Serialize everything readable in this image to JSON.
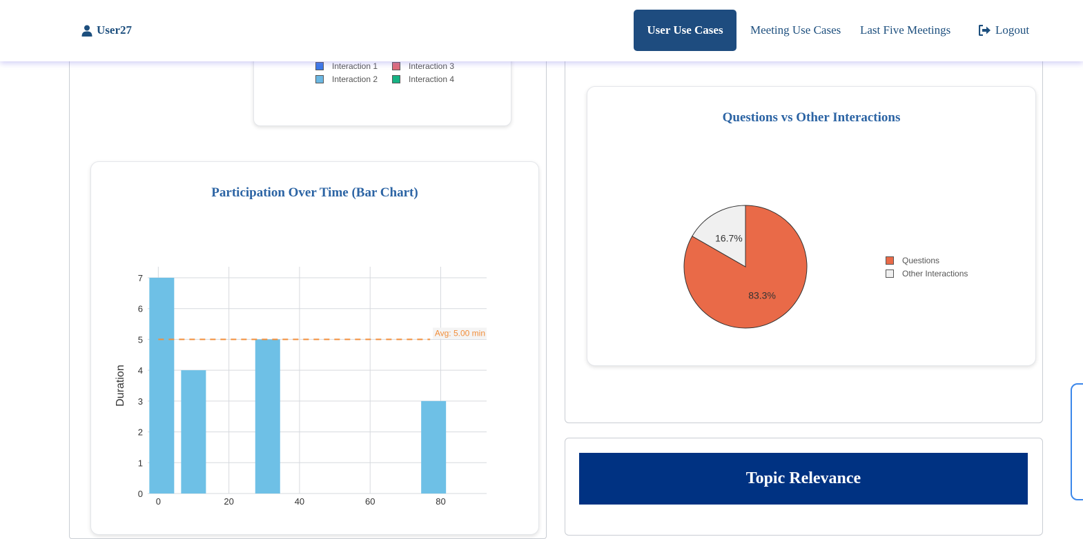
{
  "header": {
    "username": "User27",
    "nav": {
      "user_use_cases": "User Use Cases",
      "meeting_use_cases": "Meeting Use Cases",
      "last_five_meetings": "Last Five Meetings",
      "logout": "Logout"
    }
  },
  "interaction_legend": {
    "items": [
      {
        "label": "Interaction 1",
        "color": "#3b78e7"
      },
      {
        "label": "Interaction 3",
        "color": "#e06b7a"
      },
      {
        "label": "Interaction 2",
        "color": "#6bb7e2"
      },
      {
        "label": "Interaction 4",
        "color": "#16b283"
      }
    ]
  },
  "bar_card": {
    "title": "Participation Over Time (Bar Chart)"
  },
  "pie_card": {
    "title": "Questions vs Other Interactions"
  },
  "topic_relevance": {
    "title": "Topic Relevance"
  },
  "chart_data": [
    {
      "type": "bar",
      "title": "Participation Over Time (Bar Chart)",
      "xlabel": "",
      "ylabel": "Duration",
      "x": [
        0,
        9,
        30,
        77
      ],
      "values": [
        7,
        4,
        5,
        3
      ],
      "bar_color": "#6ec0e6",
      "xlim": [
        -3,
        93
      ],
      "ylim": [
        0,
        7
      ],
      "x_ticks": [
        0,
        20,
        40,
        60,
        80
      ],
      "y_ticks": [
        0,
        1,
        2,
        3,
        4,
        5,
        6,
        7
      ],
      "grid": true,
      "average_line": {
        "value": 5,
        "label": "Avg: 5.00 min",
        "color": "#f28e3a",
        "x_range": [
          0,
          77
        ]
      }
    },
    {
      "type": "pie",
      "title": "Questions vs Other Interactions",
      "slices": [
        {
          "label": "Questions",
          "value": 83.3,
          "display": "83.3%",
          "color": "#e96a48"
        },
        {
          "label": "Other Interactions",
          "value": 16.7,
          "display": "16.7%",
          "color": "#f0f0f0"
        }
      ],
      "legend_position": "right"
    }
  ]
}
